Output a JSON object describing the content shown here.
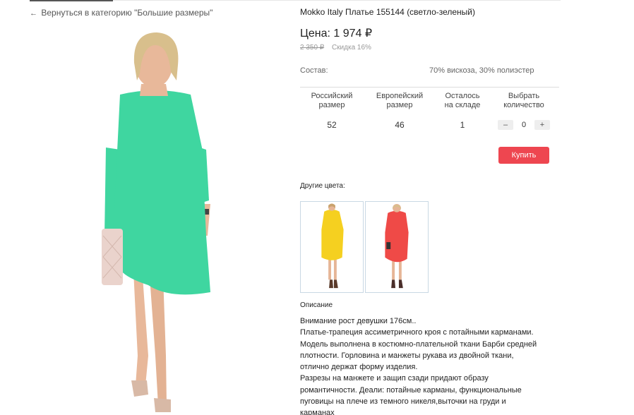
{
  "back_link": {
    "arrow": "←",
    "text": "Вернуться в категорию \"Большие размеры\""
  },
  "product": {
    "title": "Mokko Italy Платье 155144 (светло-зеленый)",
    "price": "Цена: 1 974 ₽",
    "old_price": "2 350 ₽",
    "discount": "Скидка 16%",
    "composition_label": "Состав:",
    "composition_value": "70% вискоза, 30% полиэстер"
  },
  "table": {
    "headers": [
      "Российский размер",
      "Европейский размер",
      "Осталось на складе",
      "Выбрать количество"
    ],
    "headers_l1": [
      "Российский",
      "Европейский",
      "Осталось",
      "Выбрать"
    ],
    "headers_l2": [
      "размер",
      "размер",
      "на складе",
      "количество"
    ],
    "row": {
      "ru_size": "52",
      "eu_size": "46",
      "stock": "1"
    },
    "qty": {
      "minus": "–",
      "value": "0",
      "plus": "+"
    }
  },
  "buy_label": "Купить",
  "other_colors_label": "Другие цвета:",
  "other_colors": [
    {
      "color": "#f5d020",
      "name": "yellow"
    },
    {
      "color": "#ef4a47",
      "name": "red"
    }
  ],
  "description_title": "Описание",
  "description_lines": [
    "Внимание рост девушки 176см..",
    "Платье-трапеция ассиметричного кроя с потайными карманами.",
    "Модель выполнена в костюмно-плательной ткани Барби средней",
    "плотности. Горловина и манжеты рукава  из двойной ткани,",
    "отлично держат форму изделия.",
    "Разрезы на манжете и защип  сзади  придают образу",
    "романтичности. Деали: потайные карманы, функциональные",
    "пуговицы на плече из темного никеля,выточки на груди и",
    "карманах"
  ],
  "colors": {
    "accent": "#ee4650",
    "dress_main": "#3fd6a0"
  }
}
